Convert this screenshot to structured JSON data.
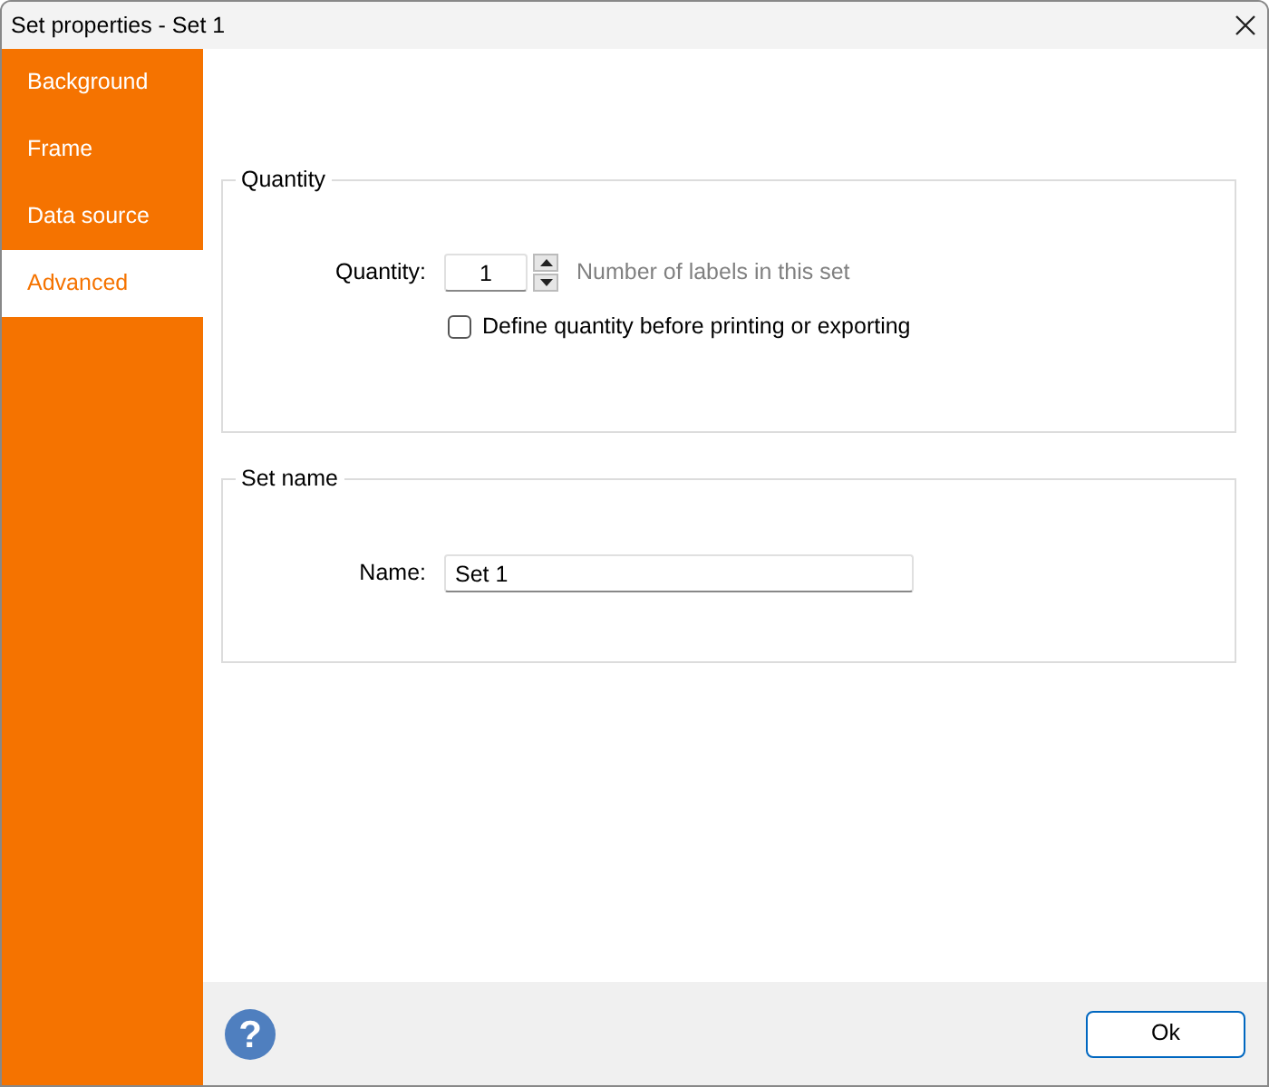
{
  "window": {
    "title": "Set properties - Set 1"
  },
  "sidebar": {
    "items": [
      {
        "label": "Background",
        "selected": false
      },
      {
        "label": "Frame",
        "selected": false
      },
      {
        "label": "Data source",
        "selected": false
      },
      {
        "label": "Advanced",
        "selected": true
      }
    ]
  },
  "quantity_group": {
    "title": "Quantity",
    "label": "Quantity:",
    "value": "1",
    "hint": "Number of labels in this set",
    "checkbox": {
      "label": "Define quantity before printing or exporting",
      "checked": false
    }
  },
  "name_group": {
    "title": "Set name",
    "label": "Name:",
    "value": "Set 1"
  },
  "footer": {
    "help_glyph": "?",
    "ok_button": "Ok"
  }
}
